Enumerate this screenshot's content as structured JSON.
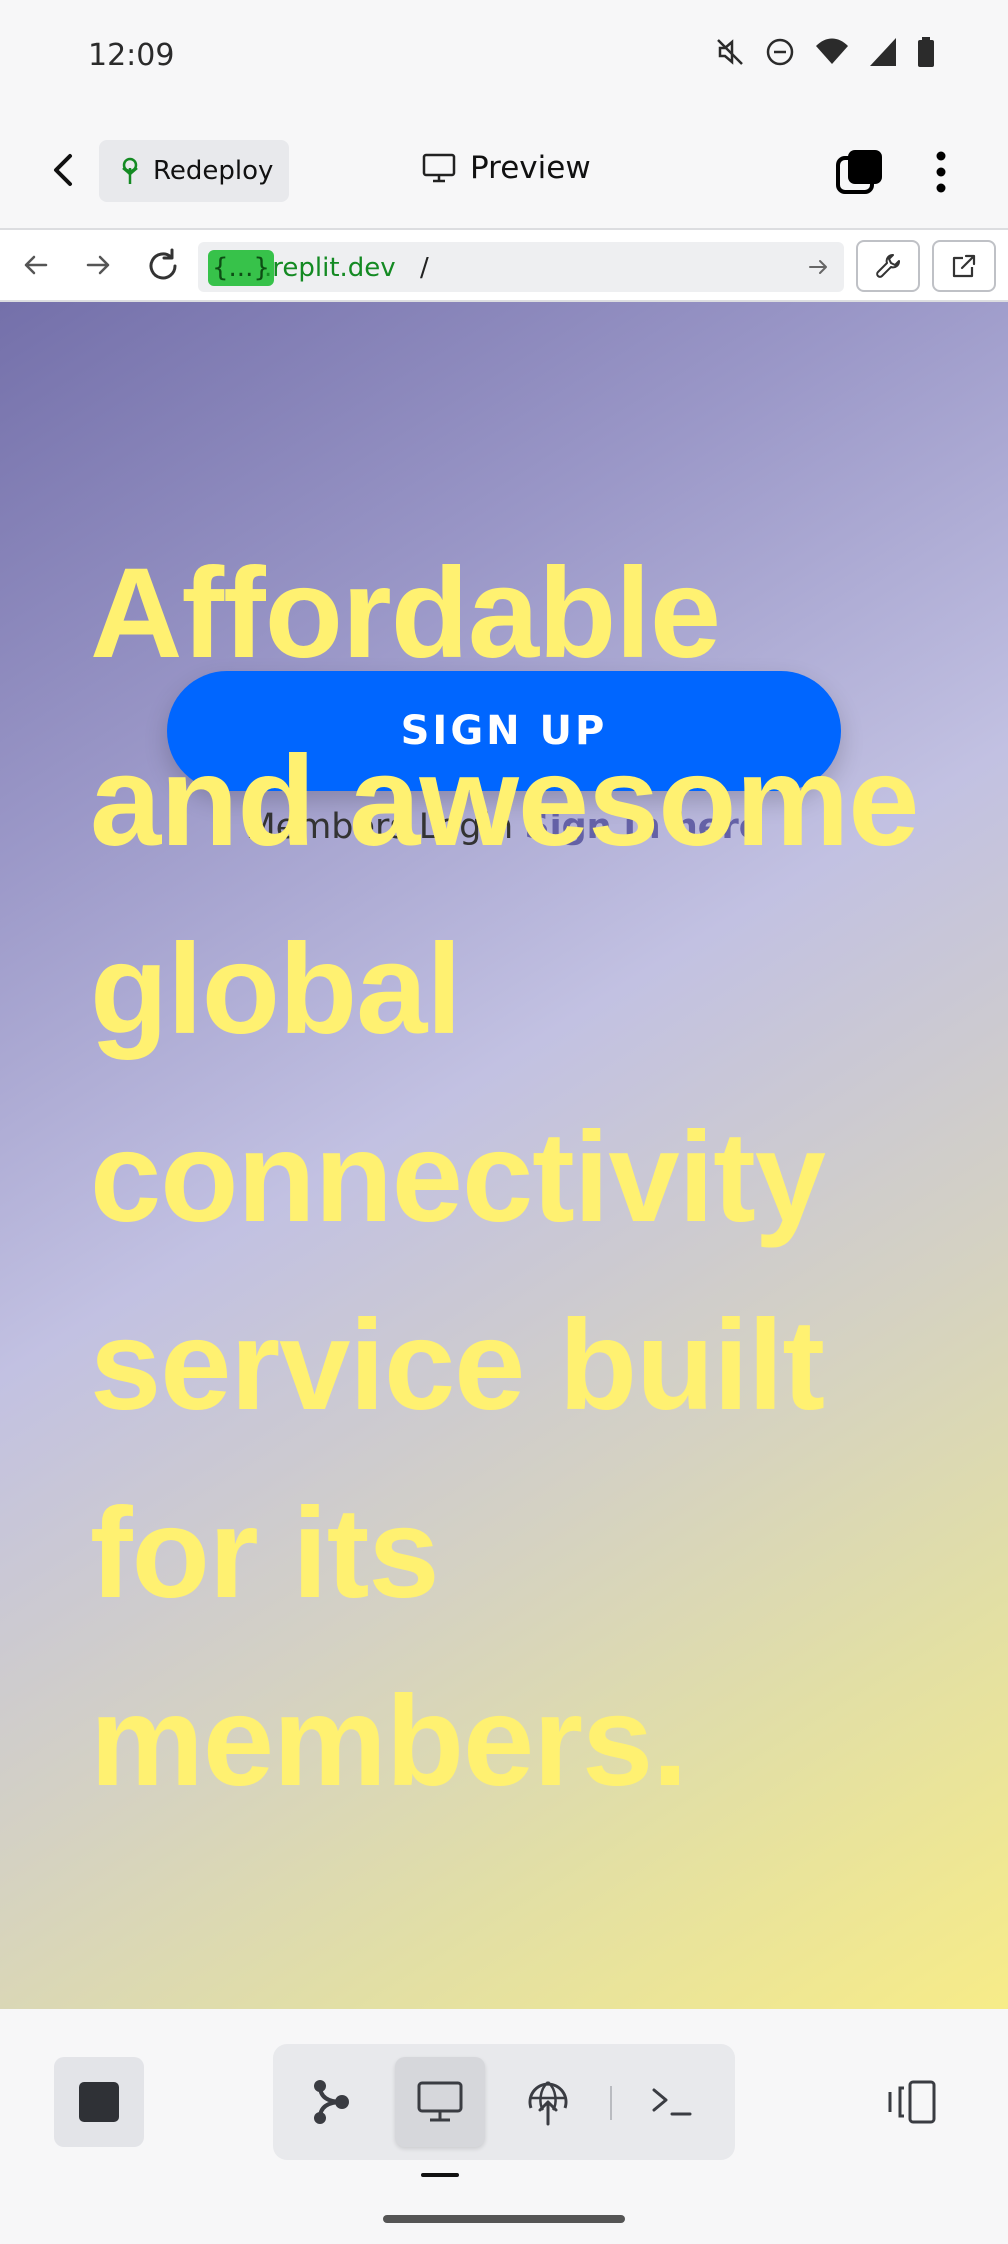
{
  "status_bar": {
    "time": "12:09"
  },
  "app_bar": {
    "redeploy_label": "Redeploy",
    "title": "Preview"
  },
  "url_bar": {
    "chip": "{...}",
    "domain": ".replit.dev",
    "path": "/"
  },
  "page": {
    "signup_label": "SIGN UP",
    "login_text": "Members Login",
    "login_link": "Sign in here",
    "headline": "Affordable and awesome global connectivity service built for its members."
  },
  "colors": {
    "accent_blue": "#0066ff",
    "headline_yellow": "#fff171",
    "link_purple": "#6461a6",
    "url_chip_green": "#37c24a",
    "url_domain_green": "#148a23"
  },
  "icons": [
    "back-arrow-icon",
    "sprout-icon",
    "monitor-icon",
    "tabs-icon",
    "more-vert-icon",
    "arrow-left-icon",
    "arrow-right-icon",
    "reload-icon",
    "arrow-go-icon",
    "wrench-icon",
    "external-link-icon",
    "stop-icon",
    "git-graph-icon",
    "globe-upload-icon",
    "terminal-icon",
    "panel-layout-icon"
  ]
}
